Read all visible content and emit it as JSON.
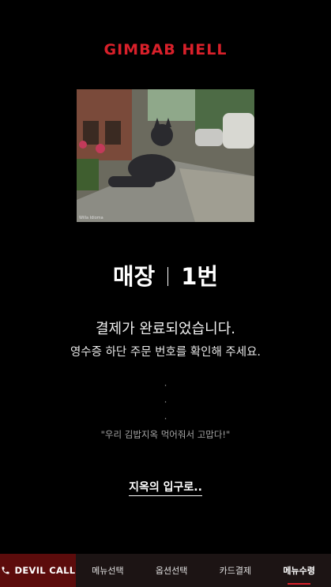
{
  "brand": {
    "logo_text": "GIMBAB HELL",
    "accent": "#d8202a"
  },
  "hero_image": {
    "description_icon": "cat-statue-photo",
    "caption": "Willa Idioma"
  },
  "order": {
    "store_label": "매장",
    "number_label": "1번"
  },
  "messages": {
    "complete": "결제가 완료되었습니다.",
    "receipt_hint": "영수증 하단 주문 번호를 확인해 주세요.",
    "dots": [
      "·",
      "·",
      "·"
    ],
    "quote": "\"우리 김밥지옥 먹어줘서 고맙다!\""
  },
  "enter_link": "지옥의 입구로..",
  "bottom_nav": {
    "call_label": "DEVIL CALL",
    "call_icon": "phone-icon",
    "items": [
      {
        "label": "메뉴선택",
        "active": false
      },
      {
        "label": "옵션선택",
        "active": false
      },
      {
        "label": "카드결제",
        "active": false
      },
      {
        "label": "메뉴수령",
        "active": true
      }
    ]
  }
}
